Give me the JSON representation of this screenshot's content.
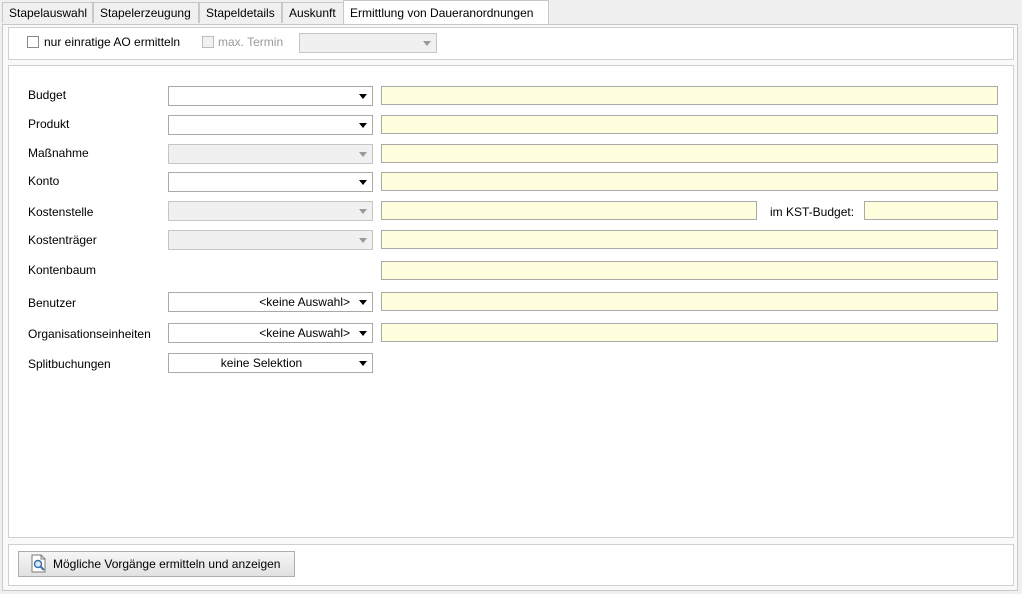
{
  "tabs": [
    {
      "label": "Stapelauswahl"
    },
    {
      "label": "Stapelerzeugung"
    },
    {
      "label": "Stapeldetails"
    },
    {
      "label": "Auskunft"
    },
    {
      "label": "Ermittlung von Daueranordnungen"
    }
  ],
  "options": {
    "einratige_label": "nur einratige AO ermitteln",
    "max_termin_label": "max. Termin",
    "max_termin_value": ""
  },
  "form": {
    "budget": {
      "label": "Budget",
      "value": ""
    },
    "produkt": {
      "label": "Produkt",
      "value": ""
    },
    "massnahme": {
      "label": "Maßnahme",
      "value": ""
    },
    "konto": {
      "label": "Konto",
      "value": ""
    },
    "kostenstelle": {
      "label": "Kostenstelle",
      "value": "",
      "kst_budget_label": "im KST-Budget:",
      "kst_budget_value": ""
    },
    "kostentraeger": {
      "label": "Kostenträger",
      "value": ""
    },
    "kontenbaum": {
      "label": "Kontenbaum"
    },
    "benutzer": {
      "label": "Benutzer",
      "value": "<keine Auswahl>"
    },
    "organisationseinheiten": {
      "label": "Organisationseinheiten",
      "value": "<keine Auswahl>"
    },
    "splitbuchungen": {
      "label": "Splitbuchungen",
      "value": "keine Selektion"
    }
  },
  "actions": {
    "search_button": "Mögliche Vorgänge ermitteln und anzeigen"
  },
  "icons": {
    "search_button_icon": "document-search-icon"
  },
  "colors": {
    "field_yellow": "#ffffdd",
    "panel_bg": "#ffffff",
    "window_bg": "#f0f0f0"
  }
}
